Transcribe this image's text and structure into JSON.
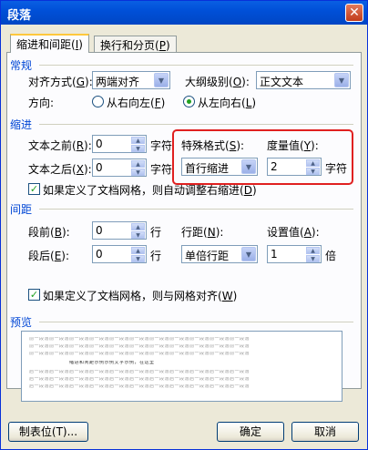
{
  "window": {
    "title": "段落",
    "close": "✕"
  },
  "tabs": [
    {
      "label": "缩进和间距",
      "key": "I",
      "active": true
    },
    {
      "label": "换行和分页",
      "key": "P",
      "active": false
    }
  ],
  "general": {
    "section": "常规",
    "align_label": "对齐方式",
    "align_key": "G",
    "align_value": "两端对齐",
    "outline_label": "大纲级别",
    "outline_key": "O",
    "outline_value": "正文文本",
    "direction_label": "方向:",
    "rtl_label": "从右向左",
    "rtl_key": "F",
    "ltr_label": "从左向右",
    "ltr_key": "L"
  },
  "indent": {
    "section": "缩进",
    "before_label": "文本之前",
    "before_key": "R",
    "before_value": "0",
    "before_unit": "字符",
    "after_label": "文本之后",
    "after_key": "X",
    "after_value": "0",
    "after_unit": "字符",
    "special_label": "特殊格式",
    "special_key": "S",
    "special_value": "首行缩进",
    "measure_label": "度量值",
    "measure_key": "Y",
    "measure_value": "2",
    "measure_unit": "字符",
    "auto_adjust": "如果定义了文档网格，则自动调整右缩进",
    "auto_adjust_key": "D"
  },
  "spacing": {
    "section": "间距",
    "before_label": "段前",
    "before_key": "B",
    "before_value": "0",
    "before_unit": "行",
    "after_label": "段后",
    "after_key": "E",
    "after_value": "0",
    "after_unit": "行",
    "line_label": "行距",
    "line_key": "N",
    "line_value": "单倍行距",
    "setting_label": "设置值",
    "setting_key": "A",
    "setting_value": "1",
    "setting_unit": "倍",
    "snap_grid": "如果定义了文档网格，则与网格对齐",
    "snap_grid_key": "W"
  },
  "preview": {
    "section": "预览",
    "prev_para": "前一段落前一段落前一段落前一段落前一段落前一段落前一段落前一段落前一段落前一段落前一段落",
    "current_para": "缩进和间距示例示例文字示例，在这里",
    "next_para": "后一段落后一段落后一段落后一段落后一段落后一段落后一段落后一段落后一段落后一段落后一段落"
  },
  "buttons": {
    "tabs": "制表位(T)...",
    "ok": "确定",
    "cancel": "取消"
  },
  "colors": {
    "section_text": "#0046d5",
    "highlight_box": "#e02020",
    "titlebar": "#0050d8"
  }
}
